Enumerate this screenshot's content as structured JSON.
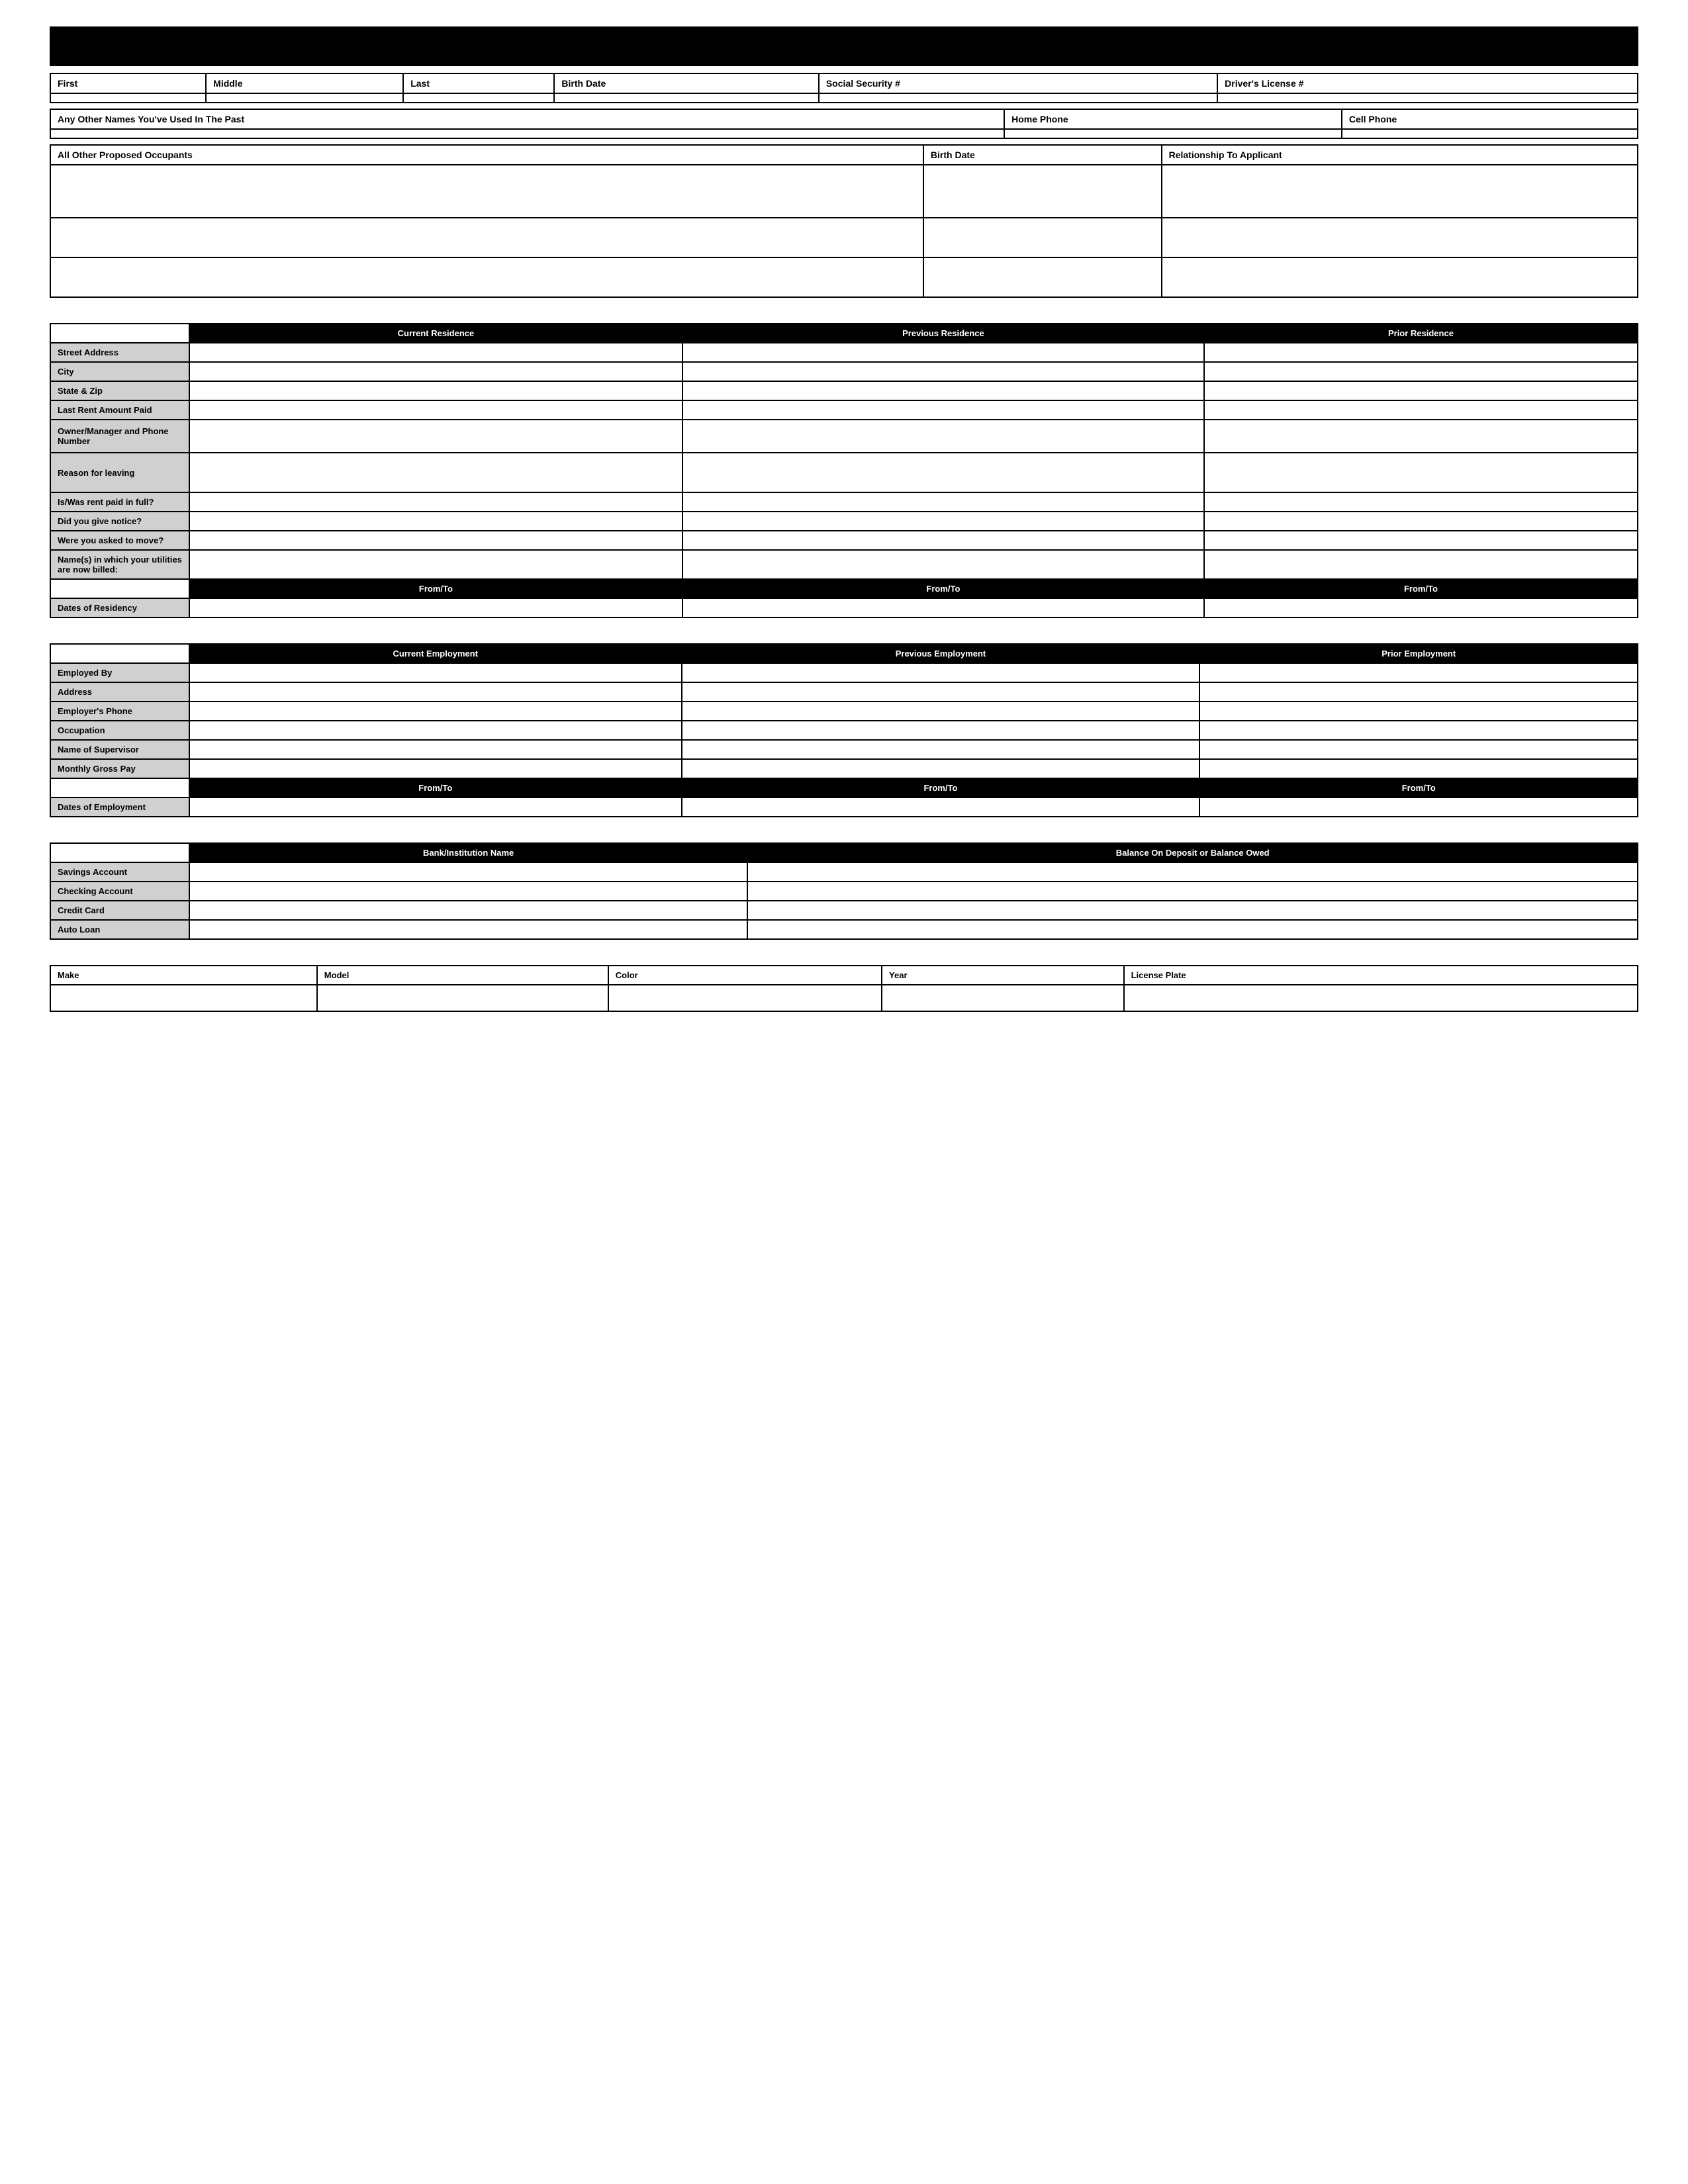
{
  "header": {
    "top_bar": "",
    "name_row": {
      "cols": [
        "First",
        "Middle",
        "Last",
        "Birth Date",
        "Social Security #",
        "Driver's License #"
      ]
    },
    "other_names_row": {
      "cols": [
        "Any Other Names You've Used In The Past",
        "Home Phone",
        "Cell Phone"
      ]
    },
    "occupants_row": {
      "cols": [
        "All Other Proposed Occupants",
        "Birth Date",
        "Relationship To Applicant"
      ]
    }
  },
  "residence_section": {
    "columns": [
      "Current Residence",
      "Previous Residence",
      "Prior Residence"
    ],
    "rows": [
      "Street Address",
      "City",
      "State & Zip",
      "Last Rent Amount Paid",
      "Owner/Manager and Phone Number",
      "Reason for leaving",
      "Is/Was rent paid in full?",
      "Did you give notice?",
      "Were you asked to move?",
      "Name(s) in which your utilities are now billed:"
    ],
    "dates_row_header": "From/To",
    "dates_label": "Dates of Residency"
  },
  "employment_section": {
    "columns": [
      "Current Employment",
      "Previous Employment",
      "Prior Employment"
    ],
    "rows": [
      "Employed By",
      "Address",
      "Employer's Phone",
      "Occupation",
      "Name of Supervisor",
      "Monthly Gross Pay"
    ],
    "dates_row_header": "From/To",
    "dates_label": "Dates of Employment"
  },
  "bank_section": {
    "columns": [
      "Bank/Institution Name",
      "Balance On Deposit or Balance Owed"
    ],
    "rows": [
      "Savings Account",
      "Checking Account",
      "Credit Card",
      "Auto Loan"
    ]
  },
  "vehicle_section": {
    "cols": [
      "Make",
      "Model",
      "Color",
      "Year",
      "License Plate"
    ]
  }
}
